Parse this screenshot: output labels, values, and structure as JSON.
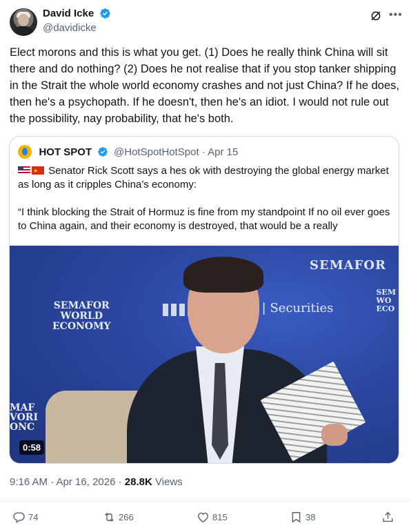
{
  "author": {
    "display_name": "David Icke",
    "handle": "@davidicke"
  },
  "tweet": {
    "text": "Elect morons and this is what you get. (1) Does he really think China will sit there and do nothing? (2) Does he not realise that if you stop tanker shipping  in the Strait the whole world economy crashes and not just China? If he does, then he's a psychopath. If he doesn't, then he's an idiot. I would not rule out the possibility, nay probability, that he's both."
  },
  "quote": {
    "display_name": "HOT SPOT",
    "handle_date": "@HotSpotHotSpot · Apr 15",
    "line1": "Senator Rick Scott says a hes ok with destroying the global energy market as long as it cripples China’s economy:",
    "line2": "“I think blocking the Strait of Hormuz is fine from my standpoint If no oil ever goes to China again, and their economy is destroyed, that would be a really",
    "video": {
      "duration": "0:58",
      "sign_top": "SEMAFOR",
      "sign_left": [
        "SEMAFOR",
        "WORLD",
        "ECONOMY"
      ],
      "sign_right": [
        "SEM",
        "WO",
        "ECO"
      ],
      "sign_bottom_left": [
        "MAF",
        "VORI",
        "ONC"
      ],
      "sign_securities": "L | Securities"
    }
  },
  "meta": {
    "time_date": "9:16 AM · Apr 16, 2026 · ",
    "views_count": "28.8K",
    "views_label": " Views"
  },
  "actions": {
    "replies": "74",
    "reposts": "266",
    "likes": "815",
    "bookmarks": "38"
  },
  "colors": {
    "verified": "#1d9bf0",
    "text_secondary": "#536471",
    "border": "#cfd9de"
  }
}
